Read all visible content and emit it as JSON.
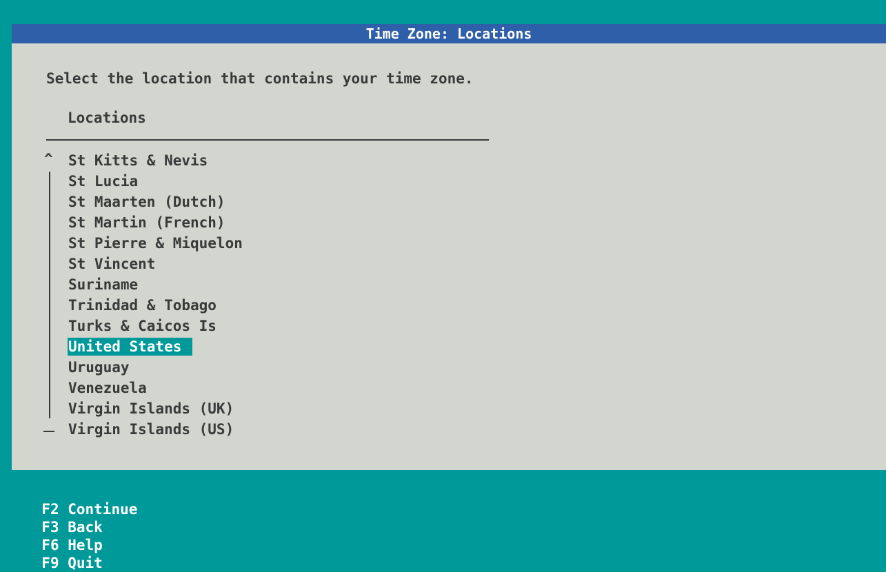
{
  "dialog": {
    "title": "Time Zone: Locations",
    "prompt": "Select the location that contains your time zone.",
    "list_header": "Locations",
    "scroll_up_glyph": "^",
    "selected": "United States",
    "locations": [
      "St Kitts & Nevis",
      "St Lucia",
      "St Maarten (Dutch)",
      "St Martin (French)",
      "St Pierre & Miquelon",
      "St Vincent",
      "Suriname",
      "Trinidad & Tobago",
      "Turks & Caicos Is",
      "United States",
      "Uruguay",
      "Venezuela",
      "Virgin Islands (UK)",
      "Virgin Islands (US)"
    ]
  },
  "footer": {
    "keys": [
      "F2 Continue",
      "F3 Back",
      "F6 Help",
      "F9 Quit"
    ]
  },
  "colors": {
    "background": "#009999",
    "title_bar": "#2e5fa8",
    "dialog": "#d3d6cf",
    "highlight": "#009999"
  }
}
